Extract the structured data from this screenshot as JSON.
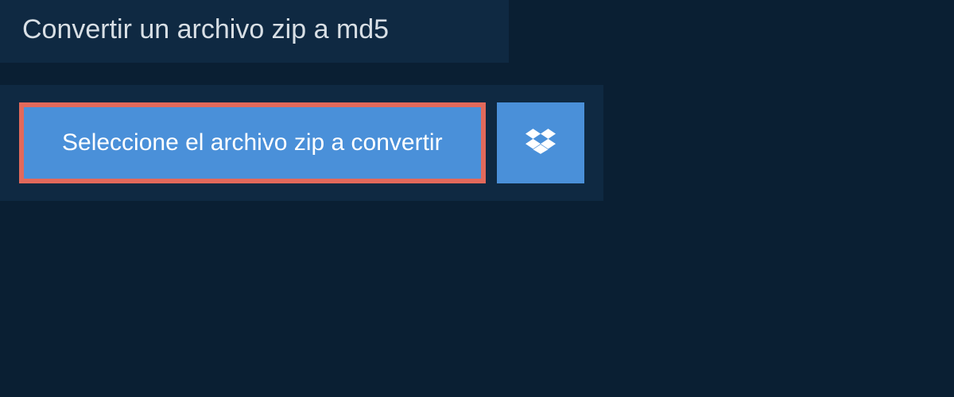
{
  "header": {
    "title": "Convertir un archivo zip a md5"
  },
  "upload": {
    "select_label": "Seleccione el archivo zip a convertir"
  },
  "colors": {
    "page_bg": "#0a1f33",
    "panel_bg": "#0f2942",
    "button_bg": "#4a90d9",
    "highlight_border": "#e2695b",
    "text_light": "#d8dfe5",
    "text_white": "#ffffff"
  }
}
